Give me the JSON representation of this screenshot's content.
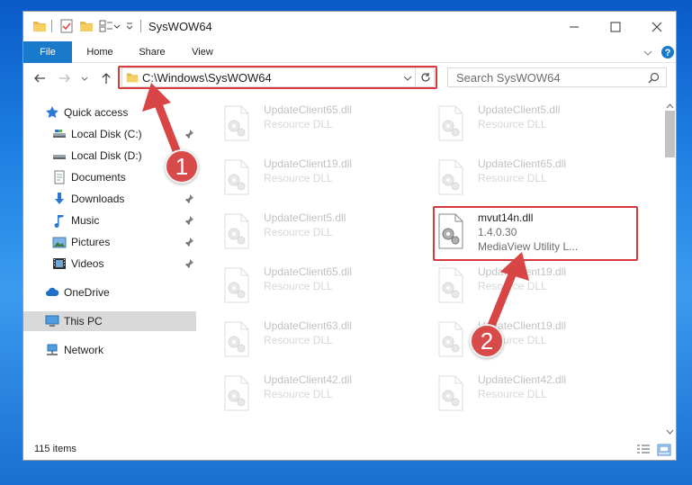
{
  "window": {
    "title": "SysWOW64"
  },
  "ribbon": {
    "tabs": [
      "File",
      "Home",
      "Share",
      "View"
    ]
  },
  "address": {
    "path": "C:\\Windows\\SysWOW64",
    "search_placeholder": "Search SysWOW64"
  },
  "nav": {
    "items": [
      {
        "label": "Quick access",
        "icon": "star-icon",
        "pinned": false
      },
      {
        "label": "Local Disk (C:)",
        "icon": "drive-icon",
        "pinned": true
      },
      {
        "label": "Local Disk (D:)",
        "icon": "drive-icon",
        "pinned": false
      },
      {
        "label": "Documents",
        "icon": "documents-icon",
        "pinned": true
      },
      {
        "label": "Downloads",
        "icon": "download-icon",
        "pinned": true
      },
      {
        "label": "Music",
        "icon": "music-icon",
        "pinned": true
      },
      {
        "label": "Pictures",
        "icon": "pictures-icon",
        "pinned": true
      },
      {
        "label": "Videos",
        "icon": "videos-icon",
        "pinned": true
      },
      {
        "label": "OneDrive",
        "icon": "cloud-icon",
        "pinned": false
      },
      {
        "label": "This PC",
        "icon": "computer-icon",
        "pinned": false,
        "selected": true
      },
      {
        "label": "Network",
        "icon": "network-icon",
        "pinned": false
      }
    ]
  },
  "files": {
    "left": [
      {
        "name": "UpdateClient65.dll",
        "type": "Resource DLL"
      },
      {
        "name": "UpdateClient19.dll",
        "type": "Resource DLL"
      },
      {
        "name": "UpdateClient5.dll",
        "type": "Resource DLL"
      },
      {
        "name": "UpdateClient65.dll",
        "type": "Resource DLL"
      },
      {
        "name": "UpdateClient63.dll",
        "type": "Resource DLL"
      },
      {
        "name": "UpdateClient42.dll",
        "type": "Resource DLL"
      }
    ],
    "right": [
      {
        "name": "UpdateClient5.dll",
        "type": "Resource DLL"
      },
      {
        "name": "UpdateClient65.dll",
        "type": "Resource DLL"
      },
      {
        "name": "mvut14n.dll",
        "version": "1.4.0.30",
        "description": "MediaView Utility L...",
        "highlighted": true
      },
      {
        "name": "UpdateClient19.dll",
        "type": "Resource DLL"
      },
      {
        "name": "UpdateClient19.dll",
        "type": "Resource DLL"
      },
      {
        "name": "UpdateClient42.dll",
        "type": "Resource DLL"
      }
    ]
  },
  "status": {
    "item_count": "115 items"
  },
  "callouts": [
    "1",
    "2"
  ],
  "colors": {
    "accent": "#1979ca",
    "highlight": "#d9393c",
    "callout": "#d84a4a"
  }
}
